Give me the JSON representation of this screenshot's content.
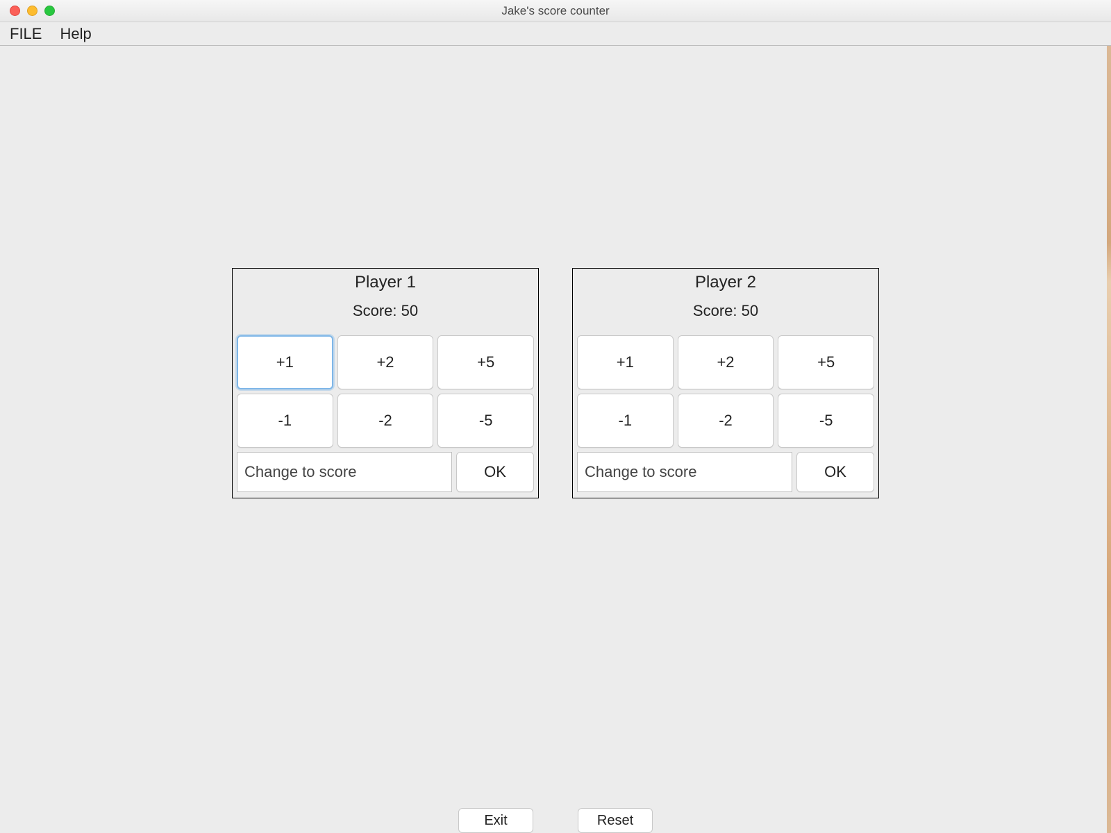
{
  "window": {
    "title": "Jake's score counter"
  },
  "menubar": {
    "file": "FILE",
    "help": "Help"
  },
  "players": [
    {
      "name": "Player 1",
      "score_label": "Score: 50",
      "buttons": {
        "p1": "+1",
        "p2": "+2",
        "p5": "+5",
        "m1": "-1",
        "m2": "-2",
        "m5": "-5"
      },
      "change_placeholder": "Change to score",
      "ok_label": "OK"
    },
    {
      "name": "Player 2",
      "score_label": "Score: 50",
      "buttons": {
        "p1": "+1",
        "p2": "+2",
        "p5": "+5",
        "m1": "-1",
        "m2": "-2",
        "m5": "-5"
      },
      "change_placeholder": "Change to score",
      "ok_label": "OK"
    }
  ],
  "footer": {
    "exit": "Exit",
    "reset": "Reset"
  }
}
